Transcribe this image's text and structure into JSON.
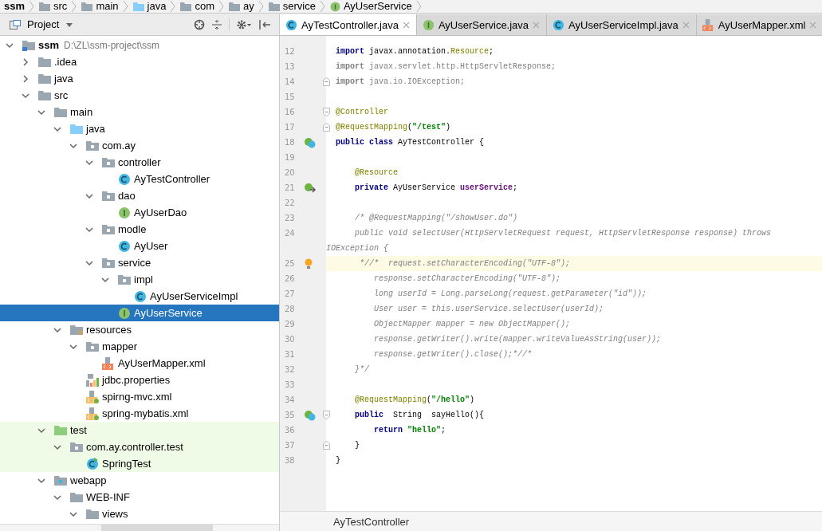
{
  "breadcrumb": [
    {
      "label": "ssm",
      "kind": "module"
    },
    {
      "label": "src",
      "kind": "folder"
    },
    {
      "label": "main",
      "kind": "folder"
    },
    {
      "label": "java",
      "kind": "source_folder"
    },
    {
      "label": "com",
      "kind": "package"
    },
    {
      "label": "ay",
      "kind": "package"
    },
    {
      "label": "service",
      "kind": "package"
    },
    {
      "label": "AyUserService",
      "kind": "interface"
    }
  ],
  "project_panel": {
    "title": "Project",
    "tree": [
      {
        "label": "ssm",
        "path_hint": "D:\\ZL\\ssm-project\\ssm",
        "kind": "module",
        "expanded": true,
        "selected": false,
        "children": [
          {
            "label": ".idea",
            "kind": "folder",
            "expanded": false,
            "selected": false
          },
          {
            "label": "java",
            "kind": "folder",
            "expanded": false,
            "selected": false
          },
          {
            "label": "src",
            "kind": "folder",
            "expanded": true,
            "selected": false,
            "children": [
              {
                "label": "main",
                "kind": "folder",
                "expanded": true,
                "selected": false,
                "children": [
                  {
                    "label": "java",
                    "kind": "source_folder",
                    "expanded": true,
                    "selected": false,
                    "children": [
                      {
                        "label": "com.ay",
                        "kind": "package",
                        "expanded": true,
                        "selected": false,
                        "children": [
                          {
                            "label": "controller",
                            "kind": "package",
                            "expanded": true,
                            "selected": false,
                            "children": [
                              {
                                "label": "AyTestController",
                                "kind": "class",
                                "selected": false
                              }
                            ]
                          },
                          {
                            "label": "dao",
                            "kind": "package",
                            "expanded": true,
                            "selected": false,
                            "children": [
                              {
                                "label": "AyUserDao",
                                "kind": "interface",
                                "selected": false
                              }
                            ]
                          },
                          {
                            "label": "modle",
                            "kind": "package",
                            "expanded": true,
                            "selected": false,
                            "children": [
                              {
                                "label": "AyUser",
                                "kind": "class",
                                "selected": false
                              }
                            ]
                          },
                          {
                            "label": "service",
                            "kind": "package",
                            "expanded": true,
                            "selected": false,
                            "children": [
                              {
                                "label": "impl",
                                "kind": "package",
                                "expanded": true,
                                "selected": false,
                                "children": [
                                  {
                                    "label": "AyUserServiceImpl",
                                    "kind": "class",
                                    "selected": false
                                  }
                                ]
                              },
                              {
                                "label": "AyUserService",
                                "kind": "interface",
                                "selected": true
                              }
                            ]
                          }
                        ]
                      }
                    ]
                  },
                  {
                    "label": "resources",
                    "kind": "resources_folder",
                    "expanded": true,
                    "selected": false,
                    "children": [
                      {
                        "label": "mapper",
                        "kind": "package",
                        "expanded": true,
                        "selected": false,
                        "children": [
                          {
                            "label": "AyUserMapper.xml",
                            "kind": "xml",
                            "selected": false
                          }
                        ]
                      },
                      {
                        "label": "jdbc.properties",
                        "kind": "properties",
                        "selected": false
                      },
                      {
                        "label": "spirng-mvc.xml",
                        "kind": "spring_xml",
                        "selected": false
                      },
                      {
                        "label": "spring-mybatis.xml",
                        "kind": "spring_xml",
                        "selected": false
                      }
                    ]
                  }
                ]
              },
              {
                "label": "test",
                "kind": "test_folder",
                "expanded": true,
                "selected": false,
                "test_scope": true,
                "children": [
                  {
                    "label": "com.ay.controller.test",
                    "kind": "package",
                    "expanded": true,
                    "selected": false,
                    "test_scope": true,
                    "children": [
                      {
                        "label": "SpringTest",
                        "kind": "test_class",
                        "selected": false,
                        "test_scope": true
                      }
                    ]
                  }
                ]
              },
              {
                "label": "webapp",
                "kind": "web_folder",
                "expanded": true,
                "selected": false,
                "children": [
                  {
                    "label": "WEB-INF",
                    "kind": "folder",
                    "expanded": true,
                    "selected": false,
                    "children": [
                      {
                        "label": "views",
                        "kind": "folder",
                        "expanded": true,
                        "selected": false
                      }
                    ]
                  }
                ]
              }
            ]
          }
        ]
      }
    ]
  },
  "editor_tabs": [
    {
      "label": "AyTestController.java",
      "kind": "class",
      "selected": true
    },
    {
      "label": "AyUserService.java",
      "kind": "interface",
      "selected": false
    },
    {
      "label": "AyUserServiceImpl.java",
      "kind": "class",
      "selected": false
    },
    {
      "label": "AyUserMapper.xml",
      "kind": "xml",
      "selected": false
    }
  ],
  "code_lines": [
    {
      "number": "12",
      "tokens": [
        {
          "t": "import",
          "kind": "keyword"
        },
        {
          "t": " javax.annotation.",
          "kind": "plain"
        },
        {
          "t": "Resource",
          "kind": "annotation"
        },
        {
          "t": ";",
          "kind": "plain"
        }
      ]
    },
    {
      "number": "13",
      "tokens": [
        {
          "t": "import",
          "kind": "unused_keyword"
        },
        {
          "t": " javax.servlet.http.HttpServletResponse;",
          "kind": "unused"
        }
      ]
    },
    {
      "number": "14",
      "fold_end": true,
      "tokens": [
        {
          "t": "import",
          "kind": "unused_keyword"
        },
        {
          "t": " java.io.IOException;",
          "kind": "unused"
        }
      ]
    },
    {
      "number": "15"
    },
    {
      "number": "16",
      "fold_start": true,
      "tokens": [
        {
          "t": "@Controller",
          "kind": "annotation"
        }
      ]
    },
    {
      "number": "17",
      "fold_end": true,
      "tokens": [
        {
          "t": "@RequestMapping",
          "kind": "annotation"
        },
        {
          "t": "(",
          "kind": "plain"
        },
        {
          "t": "\"/test\"",
          "kind": "string"
        },
        {
          "t": ")",
          "kind": "plain"
        }
      ]
    },
    {
      "number": "18",
      "gutter": {
        "kind": "bean_class"
      },
      "tokens": [
        {
          "t": "public class",
          "kind": "keyword"
        },
        {
          "t": " AyTestController {",
          "kind": "plain"
        }
      ]
    },
    {
      "number": "19"
    },
    {
      "number": "20",
      "tokens": [
        {
          "t": "    @Resource",
          "kind": "annotation"
        }
      ]
    },
    {
      "number": "21",
      "gutter": {
        "kind": "bean_field"
      },
      "tokens": [
        {
          "t": "    private",
          "kind": "keyword"
        },
        {
          "t": " AyUserService ",
          "kind": "plain"
        },
        {
          "t": "userService",
          "kind": "field"
        },
        {
          "t": ";",
          "kind": "plain"
        }
      ]
    },
    {
      "number": "22"
    },
    {
      "number": "23",
      "tokens": [
        {
          "t": "    /* @RequestMapping(\"/showUser.do\")",
          "kind": "comment"
        }
      ]
    },
    {
      "number": "24",
      "tokens": [
        {
          "t": "    public void selectUser(HttpServletRequest request, HttpServletResponse response) throws",
          "kind": "comment"
        }
      ],
      "wrap_tokens": [
        {
          "t": "IOException {",
          "kind": "comment"
        }
      ]
    },
    {
      "number": "25",
      "current": true,
      "gutter": {
        "kind": "bulb"
      },
      "tokens": [
        {
          "t": "     *//*  request.setCharacterEncoding(\"UTF-8\");",
          "kind": "comment"
        }
      ]
    },
    {
      "number": "26",
      "tokens": [
        {
          "t": "        response.setCharacterEncoding(\"UTF-8\");",
          "kind": "comment"
        }
      ]
    },
    {
      "number": "27",
      "tokens": [
        {
          "t": "        long userId = Long.parseLong(request.getParameter(\"id\"));",
          "kind": "comment"
        }
      ]
    },
    {
      "number": "28",
      "tokens": [
        {
          "t": "        User user = this.userService.selectUser(userId);",
          "kind": "comment"
        }
      ]
    },
    {
      "number": "29",
      "tokens": [
        {
          "t": "        ObjectMapper mapper = new ObjectMapper();",
          "kind": "comment"
        }
      ]
    },
    {
      "number": "30",
      "tokens": [
        {
          "t": "        response.getWriter().write(mapper.writeValueAsString(user));",
          "kind": "comment"
        }
      ]
    },
    {
      "number": "31",
      "tokens": [
        {
          "t": "        response.getWriter().close();*//*",
          "kind": "comment"
        }
      ]
    },
    {
      "number": "32",
      "tokens": [
        {
          "t": "    }*/",
          "kind": "comment"
        }
      ]
    },
    {
      "number": "33"
    },
    {
      "number": "34",
      "tokens": [
        {
          "t": "    @RequestMapping",
          "kind": "annotation"
        },
        {
          "t": "(",
          "kind": "plain"
        },
        {
          "t": "\"/hello\"",
          "kind": "string"
        },
        {
          "t": ")",
          "kind": "plain"
        }
      ]
    },
    {
      "number": "35",
      "gutter": {
        "kind": "bean_method"
      },
      "fold_start": true,
      "tokens": [
        {
          "t": "    public",
          "kind": "keyword"
        },
        {
          "t": "  String  sayHello(){",
          "kind": "plain"
        }
      ]
    },
    {
      "number": "36",
      "tokens": [
        {
          "t": "        return",
          "kind": "keyword"
        },
        {
          "t": " \"hello\"",
          "kind": "string"
        },
        {
          "t": ";",
          "kind": "plain"
        }
      ]
    },
    {
      "number": "37",
      "fold_end": true,
      "tokens": [
        {
          "t": "    }",
          "kind": "plain"
        }
      ]
    },
    {
      "number": "38",
      "tokens": [
        {
          "t": "}",
          "kind": "plain"
        }
      ]
    }
  ],
  "editor_breadcrumb": "AyTestController"
}
